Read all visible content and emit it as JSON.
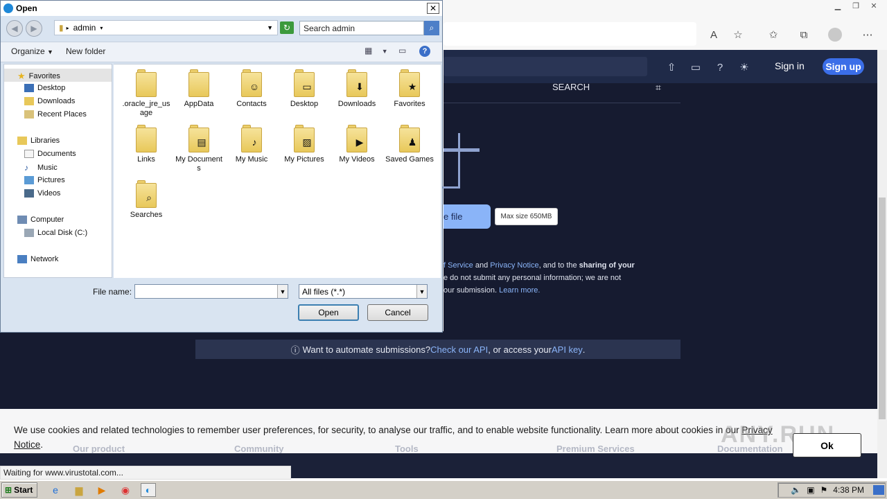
{
  "browser": {
    "toolbar_icons": [
      "read-aloud-icon",
      "favorite-add-icon",
      "favorites-icon",
      "collections-icon",
      "profile-icon",
      "more-icon"
    ],
    "status_text": "Waiting for www.virustotal.com..."
  },
  "vt": {
    "sign_in": "Sign in",
    "sign_up": "Sign up",
    "tab_search": "SEARCH",
    "choose_file": "e file",
    "max_size": "Max size 650MB",
    "terms_line1_a": "f Service",
    "terms_line1_and": " and ",
    "terms_line1_b": "Privacy Notice",
    "terms_line1_c": ", and to the ",
    "terms_line1_bold": "sharing of your",
    "terms_line2": "e do not submit any personal information; we are not",
    "terms_line3": "our submission. ",
    "learn_more": "Learn more.",
    "automate_text": "Want to automate submissions? ",
    "check_api": "Check our API",
    "automate_mid": ", or access your ",
    "api_key": "API key",
    "automate_end": "."
  },
  "footer": {
    "cols": [
      "Our product",
      "Community",
      "Tools",
      "Premium Services",
      "Documentation"
    ],
    "cookie_text": "We use cookies and related technologies to remember user preferences, for security, to analyse our traffic, and to enable website functionality. Learn more about cookies in our ",
    "privacy": "Privacy Notice",
    "cookie_end": ".",
    "ok": "Ok",
    "watermark": "ANY.RUN"
  },
  "dialog": {
    "title": "Open",
    "path": "admin",
    "search_placeholder": "Search admin",
    "organize": "Organize",
    "new_folder": "New folder",
    "nav": {
      "favorites": "Favorites",
      "desktop": "Desktop",
      "downloads": "Downloads",
      "recent": "Recent Places",
      "libraries": "Libraries",
      "documents": "Documents",
      "music": "Music",
      "pictures": "Pictures",
      "videos": "Videos",
      "computer": "Computer",
      "local_disk": "Local Disk (C:)",
      "network": "Network"
    },
    "files": [
      {
        "name": ".oracle_jre_usage",
        "icon": "folder-icon"
      },
      {
        "name": "AppData",
        "icon": "folder-icon"
      },
      {
        "name": "Contacts",
        "icon": "contacts-folder-icon"
      },
      {
        "name": "Desktop",
        "icon": "desktop-folder-icon"
      },
      {
        "name": "Downloads",
        "icon": "downloads-folder-icon"
      },
      {
        "name": "Favorites",
        "icon": "favorites-folder-icon"
      },
      {
        "name": "Links",
        "icon": "folder-icon"
      },
      {
        "name": "My Documents",
        "icon": "documents-folder-icon"
      },
      {
        "name": "My Music",
        "icon": "music-folder-icon"
      },
      {
        "name": "My Pictures",
        "icon": "pictures-folder-icon"
      },
      {
        "name": "My Videos",
        "icon": "videos-folder-icon"
      },
      {
        "name": "Saved Games",
        "icon": "games-folder-icon"
      },
      {
        "name": "Searches",
        "icon": "searches-folder-icon"
      }
    ],
    "file_name_label": "File name:",
    "file_name_value": "",
    "filter": "All files (*.*)",
    "open": "Open",
    "cancel": "Cancel"
  },
  "taskbar": {
    "start": "Start",
    "time": "4:38 PM"
  }
}
